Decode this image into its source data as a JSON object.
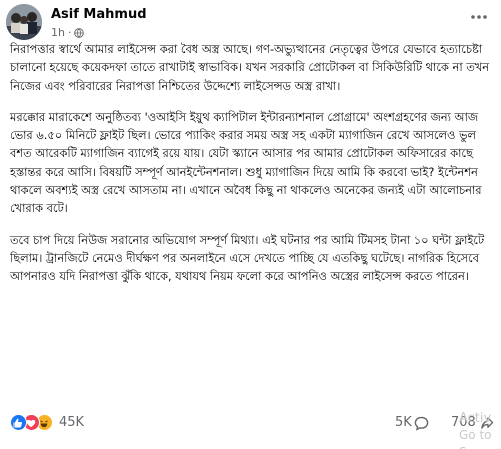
{
  "post": {
    "author": "Asif Mahmud",
    "time": "1h",
    "dot": "·",
    "paragraphs": [
      "নিরাপত্তার স্বার্থে আমার লাইসেন্স করা বৈধ অস্ত্র আছে। গণ-অভ্যুত্থানের নেতৃত্বের উপরে যেভাবে হত্যাচেষ্টা চালানো হয়েছে কয়েকদফা তাতে রাখাটাই স্বাভাবিক। যখন সরকারি প্রোটোকল বা সিকিউরিটি থাকে না তখন নিজের এবং পরিবারের নিরাপত্তা নিশ্চিতের উদ্দেশ্যে লাইসেন্সড অস্ত্র রাখা।",
      "মরক্কোর মারাকেশে অনুষ্ঠিতব্য 'ওআইসি ইয়ুথ ক্যাপিটাল ইন্টারন্যাশনাল প্রোগ্রামে' অংশগ্রহণের জন্য আজ ভোর ৬.৫০ মিনিটে ফ্লাইট ছিল। ভোরে প্যাকিং করার সময় অস্ত্র সহ একটা ম্যাগাজিন রেখে আসলেও ভুল বশত আরেকটি ম্যাগাজিন ব্যাগেই রয়ে যায়। যেটা স্ক্যানে আসার পর আমার প্রোটোকল অফিসারের কাছে হস্তান্তর করে আসি। বিষয়টি সম্পূর্ণ আনইন্টেনশনাল। শুধু ম্যাগাজিন দিয়ে আমি কি করবো ভাই? ইন্টেনশন থাকলে অবশ্যই অস্ত্র রেখে আসতাম না। এখানে অবৈধ কিছু না থাকলেও অনেকের জন্যই এটা আলোচনার খোরাক বটে।",
      "তবে চাপ দিয়ে নিউজ সরানোর অভিযোগ সম্পূর্ণ মিথ্যা। এই ঘটনার পর আমি টিমসহ টানা ১০ ঘন্টা ফ্লাইটে ছিলাম। ট্রানজিটে নেমেও দীর্ঘক্ষণ পর অনলাইনে এসে দেখতে পাচ্ছি যে এতকিছু ঘটেছে। নাগরিক হিসেবে আপনারও যদি নিরাপত্তা ঝুঁকি থাকে, যথাযথ নিয়ম ফলো করে আপনিও অস্ত্রের লাইসেন্স করতে পারেন।"
    ]
  },
  "stats": {
    "reactions_count": "45K",
    "comments_count": "5K",
    "shares_count": "708"
  },
  "watermark": {
    "line1": "Activ",
    "line2": "Go to S"
  },
  "colors": {
    "like": "#1877f2",
    "love": "#f33e58",
    "haha": "#f7b125",
    "secondary_text": "#65676b"
  }
}
